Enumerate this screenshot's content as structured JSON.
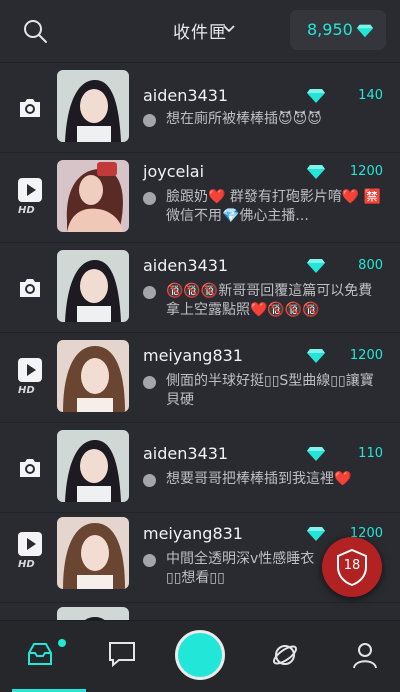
{
  "header": {
    "title": "收件匣",
    "balance": "8,950",
    "icons": {
      "search": "search-icon",
      "dropdown": "chevron-down-icon",
      "currency": "diamond-icon"
    }
  },
  "colors": {
    "accent": "#22e6d8",
    "background": "#2a2b30",
    "badge18": "#b22222"
  },
  "messages": [
    {
      "type": "photo",
      "username": "aiden3431",
      "reward": "140",
      "preview": "想在廁所被棒棒插😈😈😈",
      "avatar": "avatar-1"
    },
    {
      "type": "video",
      "hd": "HD",
      "username": "joycelai",
      "reward": "1200",
      "preview": "臉跟奶❤️ 群發有打砲影片唷❤️ 🈲微信不用💎佛心主播...",
      "avatar": "avatar-2"
    },
    {
      "type": "photo",
      "username": "aiden3431",
      "reward": "800",
      "preview": "🔞🔞🔞新哥哥回覆這篇可以免費拿上空露點照❤️🔞🔞🔞",
      "avatar": "avatar-1"
    },
    {
      "type": "video",
      "hd": "HD",
      "username": "meiyang831",
      "reward": "1200",
      "preview": "側面的半球好挺▯▯S型曲線▯▯讓寶貝硬",
      "avatar": "avatar-3"
    },
    {
      "type": "photo",
      "username": "aiden3431",
      "reward": "110",
      "preview": "想要哥哥把棒棒插到我這裡❤️",
      "avatar": "avatar-1"
    },
    {
      "type": "video",
      "hd": "HD",
      "username": "meiyang831",
      "reward": "1200",
      "preview": "中間全透明深v性感睡衣▯▯想看▯▯",
      "avatar": "avatar-3"
    }
  ],
  "fab": {
    "label": "18",
    "icon": "shield-icon"
  },
  "tabbar": {
    "tabs": [
      {
        "name": "inbox-tab",
        "icon": "inbox-icon",
        "active": true
      },
      {
        "name": "chat-tab",
        "icon": "chat-bubble-icon"
      },
      {
        "name": "live-tab",
        "icon": "record-button-icon"
      },
      {
        "name": "explore-tab",
        "icon": "planet-icon"
      },
      {
        "name": "profile-tab",
        "icon": "user-icon"
      }
    ]
  }
}
